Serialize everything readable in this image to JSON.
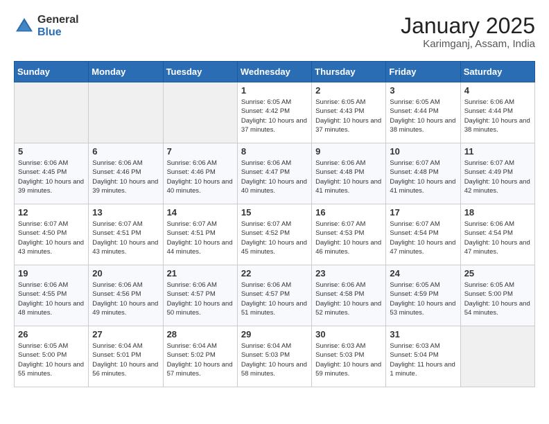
{
  "header": {
    "logo_general": "General",
    "logo_blue": "Blue",
    "month_year": "January 2025",
    "location": "Karimganj, Assam, India"
  },
  "days_of_week": [
    "Sunday",
    "Monday",
    "Tuesday",
    "Wednesday",
    "Thursday",
    "Friday",
    "Saturday"
  ],
  "weeks": [
    [
      {
        "day": "",
        "info": ""
      },
      {
        "day": "",
        "info": ""
      },
      {
        "day": "",
        "info": ""
      },
      {
        "day": "1",
        "info": "Sunrise: 6:05 AM\nSunset: 4:42 PM\nDaylight: 10 hours and 37 minutes."
      },
      {
        "day": "2",
        "info": "Sunrise: 6:05 AM\nSunset: 4:43 PM\nDaylight: 10 hours and 37 minutes."
      },
      {
        "day": "3",
        "info": "Sunrise: 6:05 AM\nSunset: 4:44 PM\nDaylight: 10 hours and 38 minutes."
      },
      {
        "day": "4",
        "info": "Sunrise: 6:06 AM\nSunset: 4:44 PM\nDaylight: 10 hours and 38 minutes."
      }
    ],
    [
      {
        "day": "5",
        "info": "Sunrise: 6:06 AM\nSunset: 4:45 PM\nDaylight: 10 hours and 39 minutes."
      },
      {
        "day": "6",
        "info": "Sunrise: 6:06 AM\nSunset: 4:46 PM\nDaylight: 10 hours and 39 minutes."
      },
      {
        "day": "7",
        "info": "Sunrise: 6:06 AM\nSunset: 4:46 PM\nDaylight: 10 hours and 40 minutes."
      },
      {
        "day": "8",
        "info": "Sunrise: 6:06 AM\nSunset: 4:47 PM\nDaylight: 10 hours and 40 minutes."
      },
      {
        "day": "9",
        "info": "Sunrise: 6:06 AM\nSunset: 4:48 PM\nDaylight: 10 hours and 41 minutes."
      },
      {
        "day": "10",
        "info": "Sunrise: 6:07 AM\nSunset: 4:48 PM\nDaylight: 10 hours and 41 minutes."
      },
      {
        "day": "11",
        "info": "Sunrise: 6:07 AM\nSunset: 4:49 PM\nDaylight: 10 hours and 42 minutes."
      }
    ],
    [
      {
        "day": "12",
        "info": "Sunrise: 6:07 AM\nSunset: 4:50 PM\nDaylight: 10 hours and 43 minutes."
      },
      {
        "day": "13",
        "info": "Sunrise: 6:07 AM\nSunset: 4:51 PM\nDaylight: 10 hours and 43 minutes."
      },
      {
        "day": "14",
        "info": "Sunrise: 6:07 AM\nSunset: 4:51 PM\nDaylight: 10 hours and 44 minutes."
      },
      {
        "day": "15",
        "info": "Sunrise: 6:07 AM\nSunset: 4:52 PM\nDaylight: 10 hours and 45 minutes."
      },
      {
        "day": "16",
        "info": "Sunrise: 6:07 AM\nSunset: 4:53 PM\nDaylight: 10 hours and 46 minutes."
      },
      {
        "day": "17",
        "info": "Sunrise: 6:07 AM\nSunset: 4:54 PM\nDaylight: 10 hours and 47 minutes."
      },
      {
        "day": "18",
        "info": "Sunrise: 6:06 AM\nSunset: 4:54 PM\nDaylight: 10 hours and 47 minutes."
      }
    ],
    [
      {
        "day": "19",
        "info": "Sunrise: 6:06 AM\nSunset: 4:55 PM\nDaylight: 10 hours and 48 minutes."
      },
      {
        "day": "20",
        "info": "Sunrise: 6:06 AM\nSunset: 4:56 PM\nDaylight: 10 hours and 49 minutes."
      },
      {
        "day": "21",
        "info": "Sunrise: 6:06 AM\nSunset: 4:57 PM\nDaylight: 10 hours and 50 minutes."
      },
      {
        "day": "22",
        "info": "Sunrise: 6:06 AM\nSunset: 4:57 PM\nDaylight: 10 hours and 51 minutes."
      },
      {
        "day": "23",
        "info": "Sunrise: 6:06 AM\nSunset: 4:58 PM\nDaylight: 10 hours and 52 minutes."
      },
      {
        "day": "24",
        "info": "Sunrise: 6:05 AM\nSunset: 4:59 PM\nDaylight: 10 hours and 53 minutes."
      },
      {
        "day": "25",
        "info": "Sunrise: 6:05 AM\nSunset: 5:00 PM\nDaylight: 10 hours and 54 minutes."
      }
    ],
    [
      {
        "day": "26",
        "info": "Sunrise: 6:05 AM\nSunset: 5:00 PM\nDaylight: 10 hours and 55 minutes."
      },
      {
        "day": "27",
        "info": "Sunrise: 6:04 AM\nSunset: 5:01 PM\nDaylight: 10 hours and 56 minutes."
      },
      {
        "day": "28",
        "info": "Sunrise: 6:04 AM\nSunset: 5:02 PM\nDaylight: 10 hours and 57 minutes."
      },
      {
        "day": "29",
        "info": "Sunrise: 6:04 AM\nSunset: 5:03 PM\nDaylight: 10 hours and 58 minutes."
      },
      {
        "day": "30",
        "info": "Sunrise: 6:03 AM\nSunset: 5:03 PM\nDaylight: 10 hours and 59 minutes."
      },
      {
        "day": "31",
        "info": "Sunrise: 6:03 AM\nSunset: 5:04 PM\nDaylight: 11 hours and 1 minute."
      },
      {
        "day": "",
        "info": ""
      }
    ]
  ]
}
